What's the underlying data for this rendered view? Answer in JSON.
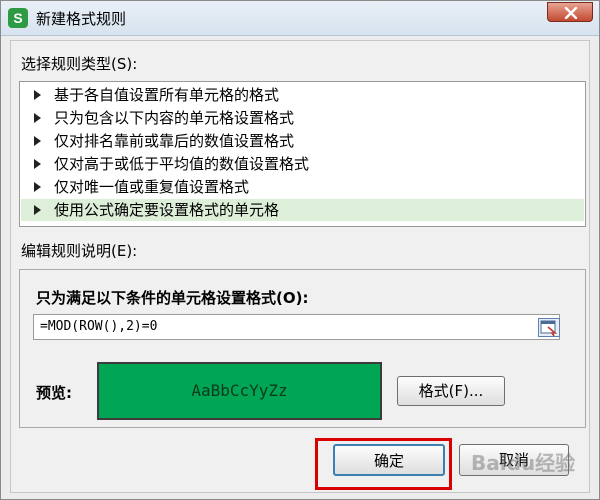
{
  "window": {
    "title": "新建格式规则",
    "app_icon_letter": "S"
  },
  "rule_types": {
    "label": "选择规则类型(S):",
    "items": [
      "基于各自值设置所有单元格的格式",
      "只为包含以下内容的单元格设置格式",
      "仅对排名靠前或靠后的数值设置格式",
      "仅对高于或低于平均值的数值设置格式",
      "仅对唯一值或重复值设置格式",
      "使用公式确定要设置格式的单元格"
    ],
    "selected_index": 5
  },
  "description": {
    "label": "编辑规则说明(E):",
    "condition_label": "只为满足以下条件的单元格设置格式(O):",
    "formula_value": "=MOD(ROW(),2)=0",
    "preview_label": "预览:",
    "preview_text": "AaBbCcYyZz",
    "format_button": "格式(F)..."
  },
  "footer": {
    "ok_label": "确定",
    "cancel_label": "取消"
  },
  "colors": {
    "preview_fill": "#00a653",
    "selected_row": "#ddeed9",
    "highlight": "#d90000"
  },
  "watermark": "Baidu经验"
}
